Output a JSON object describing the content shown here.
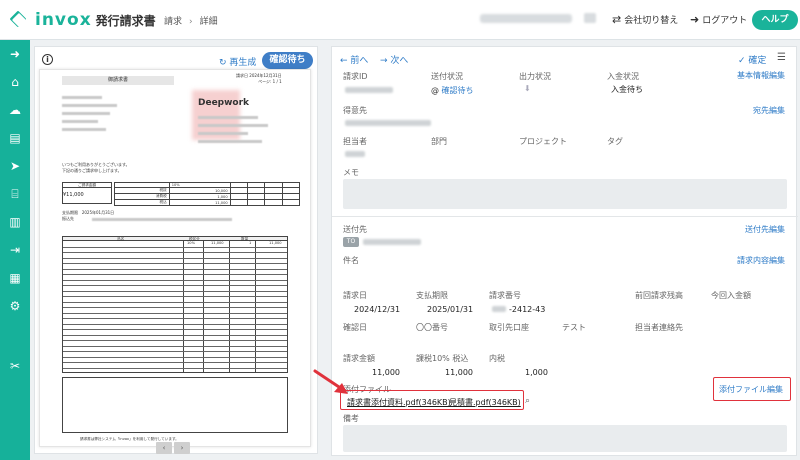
{
  "header": {
    "logo_word": "invox",
    "logo_sub": "発行請求書",
    "breadcrumb": [
      "請求",
      "詳細"
    ],
    "switch_company": "会社切り替え",
    "logout": "ログアウト",
    "help": "ヘルプ"
  },
  "sidebar": {
    "icons": [
      "arrow-right-circle-icon",
      "home-icon",
      "cloud-upload-icon",
      "document-icon",
      "send-icon",
      "bank-icon",
      "building-icon",
      "export-icon",
      "chart-icon",
      "gear-icon",
      "tool-icon"
    ]
  },
  "preview": {
    "regenerate": "再生成",
    "status_button": "確認待ち",
    "doc_title": "御請求書",
    "doc_meta": [
      "請求日 2024年12月31日",
      "ページ: 1 / 1"
    ],
    "company_logo": "Deepwork",
    "greeting": [
      "いつもご利用ありがとうございます。",
      "下記の通りご請求申し上げます。"
    ],
    "amount_label": "ご請求金額",
    "amount_value": "¥11,000",
    "tax_rate": "10%",
    "tax_rows": [
      {
        "label": "税抜",
        "value": "10,000"
      },
      {
        "label": "消費税",
        "value": "1,000"
      },
      {
        "label": "税込",
        "value": "11,000"
      }
    ],
    "due_label": "支払期限",
    "due_value": "2025年01月31日",
    "bank_label": "振込先",
    "items_header": [
      "品名",
      "税区分",
      "数量"
    ],
    "item_row": {
      "tax": "10%",
      "price": "11,000",
      "qty": "1",
      "amount": "11,000"
    },
    "footer_note": "請求書は弊社システム「invox」を利用して発行しています。",
    "pager": [
      "‹",
      "›"
    ]
  },
  "detail": {
    "prev": "前へ",
    "next": "次へ",
    "confirm": "確定",
    "labels": {
      "invoice_id": "請求ID",
      "send_status": "送付状況",
      "output_status": "出力状況",
      "payment_status": "入金状況",
      "recipient": "得意先",
      "person": "担当者",
      "department": "部門",
      "project": "プロジェクト",
      "tag": "タグ",
      "memo": "メモ",
      "send_to": "送付先",
      "subject": "件名",
      "invoice_date": "請求日",
      "due_date": "支払期限",
      "invoice_number": "請求番号",
      "prev_balance": "前回請求残高",
      "this_payment": "今回入金額",
      "confirm_date": "確認日",
      "oo_number": "〇〇番号",
      "bank_account": "取引先口座",
      "test": "テスト",
      "contact_person": "担当者連絡先",
      "amount": "請求金額",
      "taxable": "課税10% 税込",
      "included_tax": "内税",
      "attachments": "添付ファイル",
      "remarks": "備考"
    },
    "values": {
      "send_status": "確認待ち",
      "payment_status": "入金待ち",
      "invoice_date": "2024/12/31",
      "due_date": "2025/01/31",
      "invoice_number": "-2412-43",
      "amount": "11,000",
      "taxable": "11,000",
      "included_tax": "1,000"
    },
    "edit_links": {
      "basic": "基本情報編集",
      "recipient": "宛先編集",
      "send_to": "送付先編集",
      "content": "請求内容編集",
      "attachments": "添付ファイル編集"
    },
    "to_badge": "TO",
    "files": [
      "請求書添付資料.pdf(346KB)",
      "見積書.pdf(346KB)"
    ]
  }
}
